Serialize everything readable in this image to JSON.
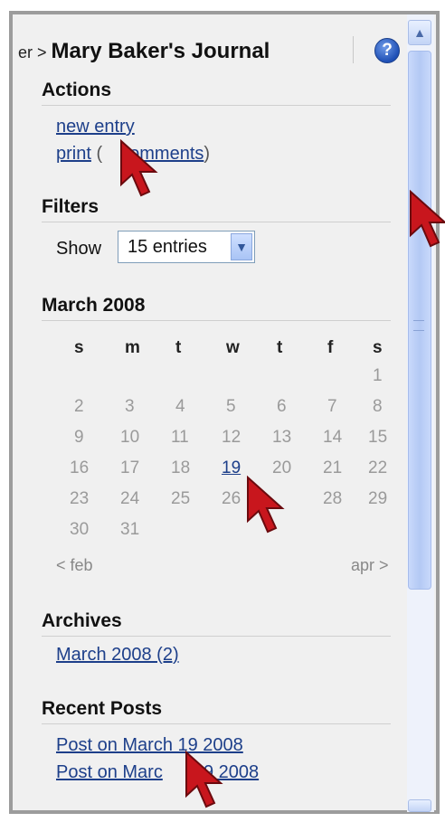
{
  "header": {
    "breadcrumb_prefix": "er > ",
    "title": "Mary Baker's Journal",
    "help_label": "?"
  },
  "actions": {
    "heading": "Actions",
    "new_entry": "new entry",
    "print": "print",
    "print_paren_open": " (",
    "comments_partial": "comments",
    "print_paren_close": ")"
  },
  "filters": {
    "heading": "Filters",
    "show_label": "Show",
    "selected": "15 entries"
  },
  "calendar": {
    "heading": "March 2008",
    "days": [
      "s",
      "m",
      "t",
      "w",
      "t",
      "f",
      "s"
    ],
    "weeks": [
      [
        "",
        "",
        "",
        "",
        "",
        "",
        "1"
      ],
      [
        "2",
        "3",
        "4",
        "5",
        "6",
        "7",
        "8"
      ],
      [
        "9",
        "10",
        "11",
        "12",
        "13",
        "14",
        "15"
      ],
      [
        "16",
        "17",
        "18",
        "19",
        "20",
        "21",
        "22"
      ],
      [
        "23",
        "24",
        "25",
        "26",
        "",
        "28",
        "29"
      ],
      [
        "30",
        "31",
        "",
        "",
        "",
        "",
        ""
      ]
    ],
    "linked_day": "19",
    "prev": "< feb",
    "next": "apr >"
  },
  "archives": {
    "heading": "Archives",
    "items": [
      "March 2008 (2)"
    ]
  },
  "recent": {
    "heading": "Recent Posts",
    "items": [
      "Post on March 19 2008",
      "Post on Marc",
      "19 2008"
    ]
  },
  "icons": {
    "cursor": "cursor-arrow-icon",
    "help": "help-circle-icon",
    "dropdown": "chevron-down-icon"
  },
  "colors": {
    "link": "#1d3f8a",
    "panel_bg": "#f0f0f0",
    "scroll_thumb": "#b3c9f4",
    "cursor_red": "#c8161d"
  }
}
